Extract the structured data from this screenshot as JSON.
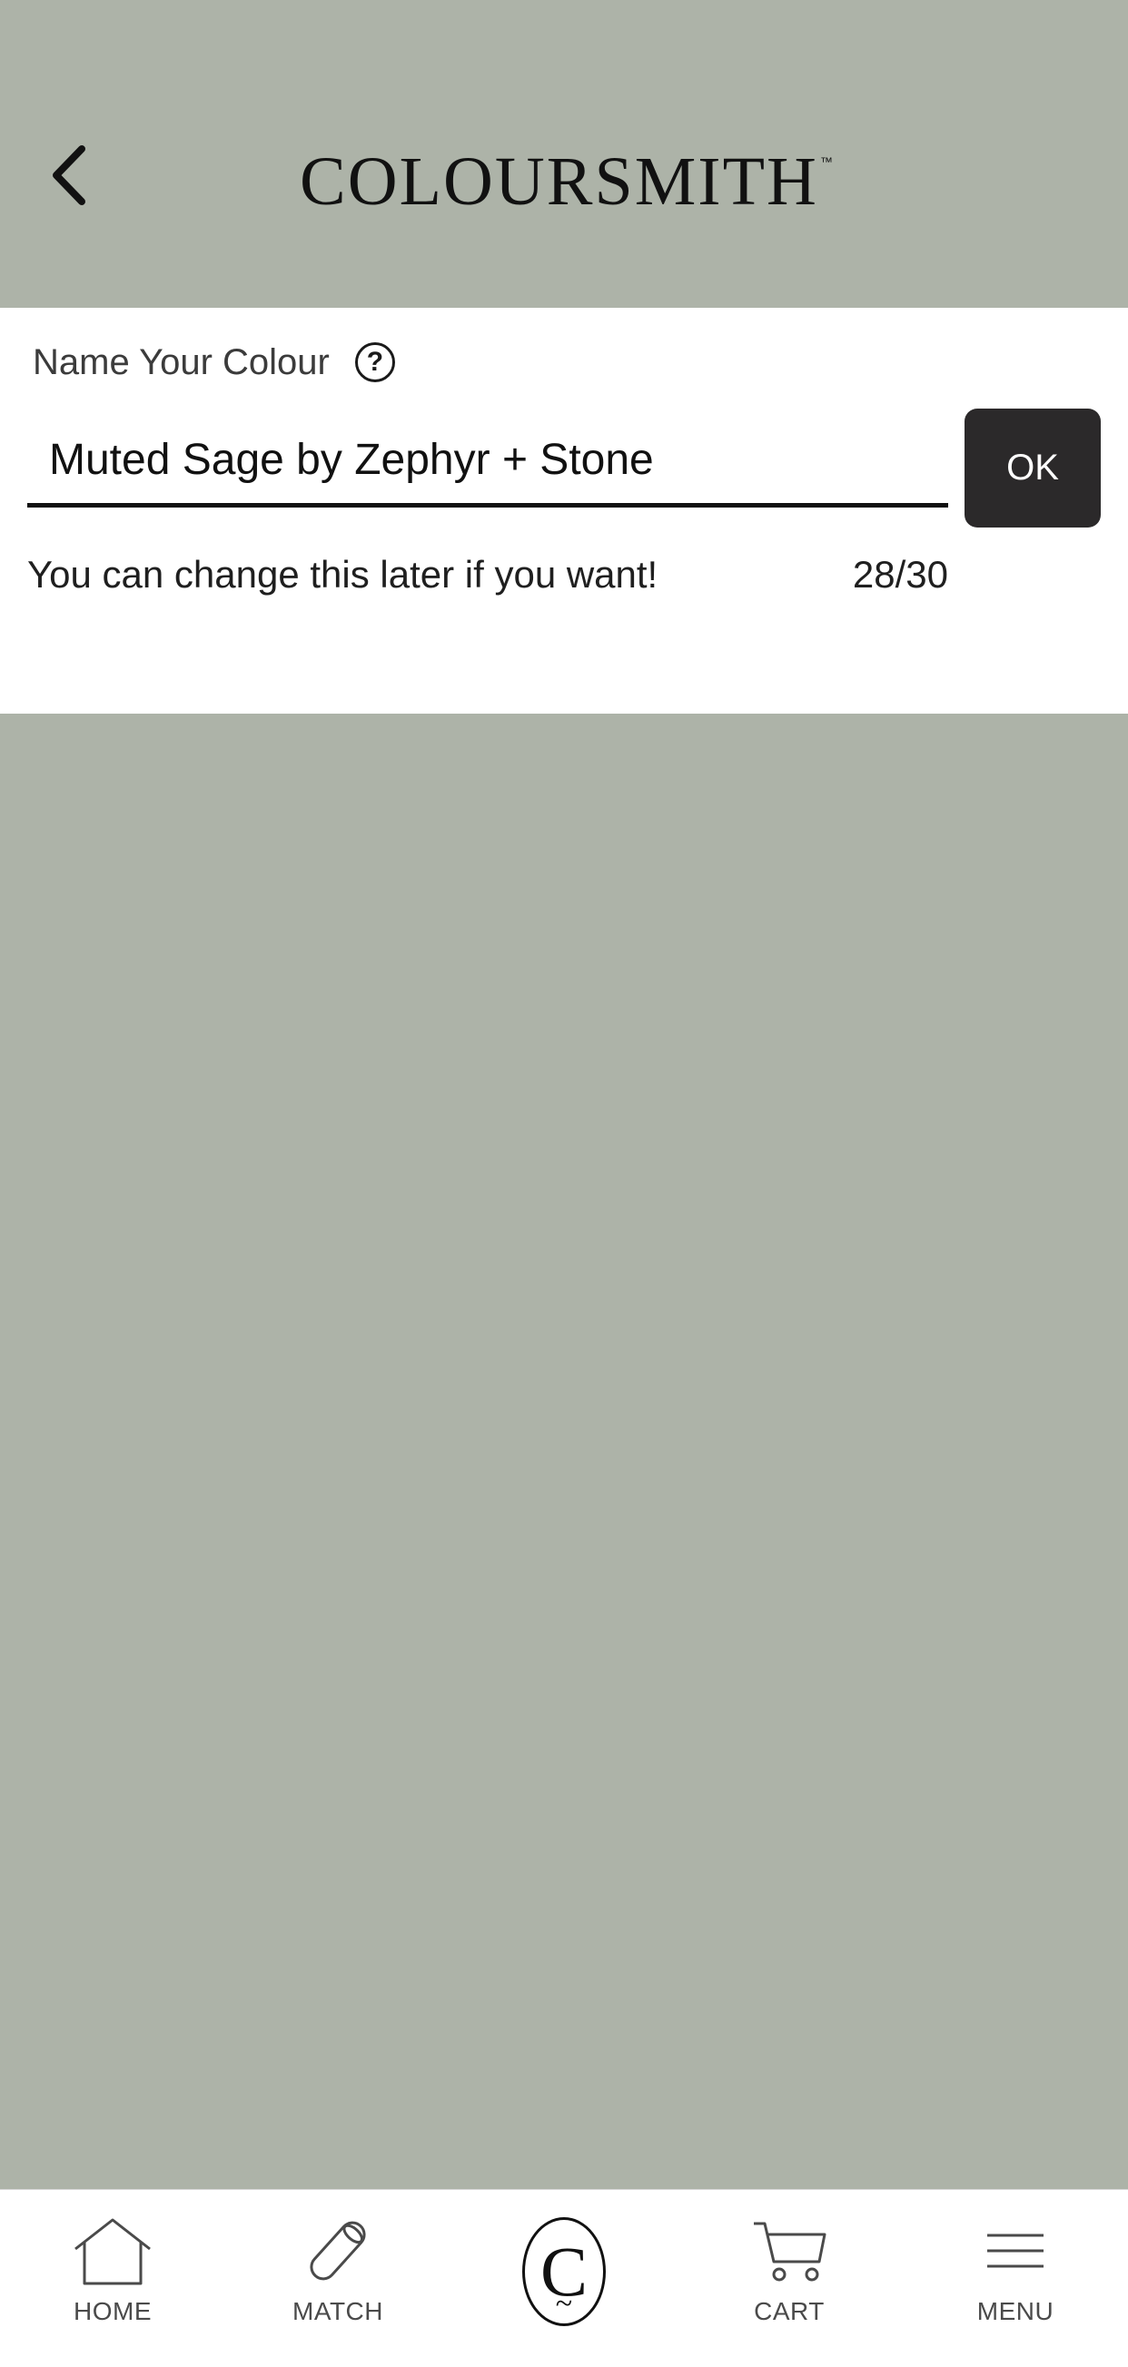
{
  "colors": {
    "swatch": "#adb3a8",
    "panel": "#ffffff",
    "ok_button_bg": "#2b292a",
    "text": "#1f1f1f"
  },
  "header": {
    "back_icon": "chevron-left-icon",
    "logo_text": "COLOURSMITH",
    "logo_tm": "™"
  },
  "name_panel": {
    "label": "Name Your Colour",
    "help_icon": "question-circle-icon",
    "help_glyph": "?",
    "input_value": "Muted Sage by Zephyr + Stone",
    "ok_label": "OK",
    "hint": "You can change this later if you want!",
    "char_count": "28/30"
  },
  "bottom_nav": {
    "items": [
      {
        "label": "HOME",
        "icon": "home-icon"
      },
      {
        "label": "MATCH",
        "icon": "paint-roller-icon"
      },
      {
        "label": "",
        "icon": "coloursmith-logo-icon"
      },
      {
        "label": "CART",
        "icon": "cart-icon"
      },
      {
        "label": "MENU",
        "icon": "hamburger-menu-icon"
      }
    ],
    "center_glyph": "C",
    "center_tilde": "~"
  }
}
